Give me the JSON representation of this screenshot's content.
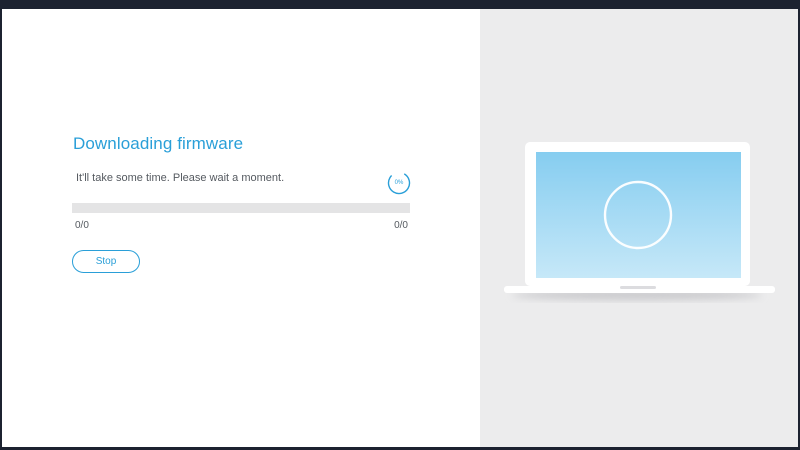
{
  "download": {
    "title": "Downloading firmware",
    "message": "It'll take some time. Please wait a moment.",
    "percent_label": "0%",
    "progress_fraction": 0,
    "count_left": "0/0",
    "count_right": "0/0",
    "stop_label": "Stop"
  },
  "illustration": {
    "icon": "laptop-icon",
    "spinner_icon": "loading-ring-icon"
  },
  "colors": {
    "accent": "#2a9fd8",
    "track": "#e4e4e5",
    "panel": "#ececed",
    "screen_top": "#86cdf0",
    "screen_bottom": "#c6e8f8"
  }
}
